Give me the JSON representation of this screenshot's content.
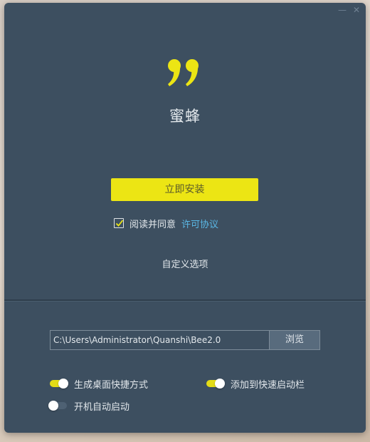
{
  "window": {
    "controls": {
      "minimize_symbol": "—",
      "close_symbol": "✕"
    }
  },
  "app": {
    "logo_icon": "quote-marks-icon",
    "name": "蜜蜂"
  },
  "install": {
    "button_label": "立即安装"
  },
  "agreement": {
    "checked": true,
    "text": "阅读并同意",
    "link_text": "许可协议"
  },
  "custom_options_label": "自定义选项",
  "install_path": {
    "value": "C:\\Users\\Administrator\\Quanshi\\Bee2.0",
    "browse_label": "浏览"
  },
  "options": {
    "desktop_shortcut": {
      "label": "生成桌面快捷方式",
      "enabled": true
    },
    "quick_launch": {
      "label": "添加到快速启动栏",
      "enabled": true
    },
    "auto_start": {
      "label": "开机自动启动",
      "enabled": false
    }
  },
  "colors": {
    "window_bg": "#3d4f60",
    "accent_yellow": "#ece514",
    "link_blue": "#5ab8e6"
  }
}
